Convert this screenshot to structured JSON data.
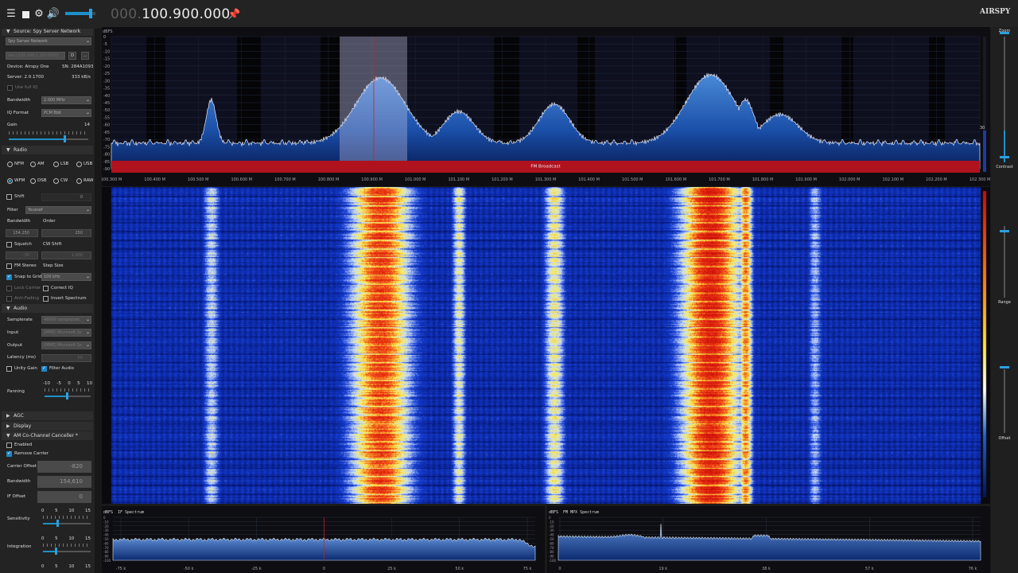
{
  "topbar": {
    "freq_dim": "000.",
    "freq_main": "100.900.000",
    "logo": "AIRSPY",
    "volume_level": 0.85
  },
  "source": {
    "header": "Source: Spy Server Network",
    "source_select": "Spy Server Network",
    "uri_placeholder": "sdr://192.168.1.103:5555",
    "connect_label": "D",
    "more_label": "...",
    "device": "Device: Airspy One",
    "serial": "SN: 284A1093",
    "server": "Server: 2.0.1700",
    "rate": "333 kB/s",
    "use_full_iq": "Use full IQ",
    "bandwidth_label": "Bandwidth",
    "bandwidth_value": "2.000 MHz",
    "iq_format_label": "IQ Format",
    "iq_format_value": "PCM 8bit",
    "gain_label": "Gain",
    "gain_value": "14",
    "gain_level": 0.7
  },
  "radio": {
    "header": "Radio",
    "modes": [
      "NFM",
      "AM",
      "LSB",
      "USB",
      "WFM",
      "DSB",
      "CW",
      "RAW"
    ],
    "selected_mode": "WFM",
    "shift_label": "Shift",
    "shift_value": "0",
    "filter_label": "Filter",
    "filter_value": "Youssef",
    "bandwidth_label": "Bandwidth",
    "order_label": "Order",
    "bandwidth_value": "154,250",
    "order_value": "250",
    "squelch_label": "Squelch",
    "cw_shift_label": "CW Shift",
    "squelch_value": "-30",
    "cw_shift_value": "1,000",
    "fm_stereo_label": "FM Stereo",
    "step_size_label": "Step Size",
    "snap_label": "Snap to Grid",
    "step_value": "100 kHz",
    "lock_carrier": "Lock Carrier",
    "correct_iq": "Correct IQ",
    "anti_fading": "Anti-Fading",
    "invert_spectrum": "Invert Spectrum"
  },
  "audio": {
    "header": "Audio",
    "samplerate_label": "Samplerate",
    "samplerate_value": "48000 sample/sec",
    "input_label": "Input",
    "input_value": "[MME] Microsoft So",
    "output_label": "Output",
    "output_value": "[MME] Microsoft So",
    "latency_label": "Latency (ms)",
    "latency_value": "50",
    "unity_gain": "Unity Gain",
    "filter_audio": "Filter Audio",
    "panning_label": "Panning",
    "panning_ticks": [
      "-10",
      "-5",
      "0",
      "5",
      "10"
    ]
  },
  "agc": {
    "header": "AGC"
  },
  "display": {
    "header": "Display"
  },
  "amcc": {
    "header": "AM Co-Channel Canceller *",
    "enabled": "Enabled",
    "remove_carrier": "Remove Carrier",
    "carrier_offset_label": "Carrier Offset",
    "carrier_offset_value": "-820",
    "bandwidth_label": "Bandwidth",
    "bandwidth_value": "154,610",
    "if_offset_label": "IF Offset",
    "if_offset_value": "0",
    "sensitivity_label": "Sensitivity",
    "integration_label": "Integration",
    "scale_ticks": [
      "0",
      "5",
      "10",
      "15"
    ]
  },
  "spectrum": {
    "unit": "dBFS",
    "db_labels": [
      "0",
      "-5",
      "-10",
      "-15",
      "-20",
      "-25",
      "-30",
      "-35",
      "-40",
      "-45",
      "-50",
      "-55",
      "-60",
      "-65",
      "-70",
      "-75",
      "-80",
      "-85",
      "-90"
    ],
    "freq_labels": [
      "100.300 M",
      "100.400 M",
      "100.500 M",
      "100.600 M",
      "100.700 M",
      "100.800 M",
      "100.900 M",
      "101.000 M",
      "101.100 M",
      "101.200 M",
      "101.300 M",
      "101.400 M",
      "101.500 M",
      "101.600 M",
      "101.700 M",
      "101.800 M",
      "101.900 M",
      "102.000 M",
      "102.100 M",
      "102.200 M",
      "102.300 M"
    ],
    "band_label": "FM Broadcast",
    "marker_value": "30"
  },
  "right_panel": {
    "zoom": "Zoom",
    "contrast": "Contrast",
    "range": "Range",
    "offset": "Offset"
  },
  "if_spectrum": {
    "unit": "dBFS",
    "title": "IF Spectrum",
    "x_labels": [
      "-75 k",
      "-50 k",
      "-25 k",
      "0",
      "25 k",
      "50 k",
      "75 k"
    ]
  },
  "mpx_spectrum": {
    "unit": "dBFS",
    "title": "FM MPX Spectrum",
    "x_labels": [
      "0",
      "19 k",
      "38 k",
      "57 k",
      "76 k"
    ]
  },
  "colors": {
    "accent": "#1e90c8",
    "band_bar": "#b0121e",
    "spectrum_fill": "#1f5fb8",
    "waterfall_bg": "#0a2a9a"
  }
}
